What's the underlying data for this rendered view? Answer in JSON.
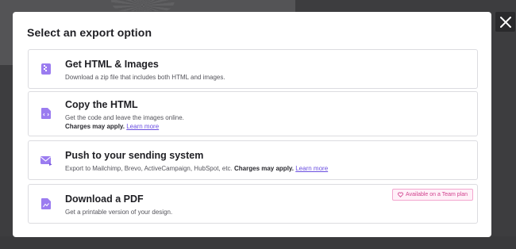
{
  "modal": {
    "title": "Select an export option",
    "close_icon": "close-icon"
  },
  "options": [
    {
      "icon": "zip-file-icon",
      "title": "Get HTML & Images",
      "desc": "Download a zip file that includes both HTML and images."
    },
    {
      "icon": "code-file-icon",
      "title": "Copy the HTML",
      "desc": "Get the code and leave the images online.",
      "charges": "Charges may apply.",
      "link": "Learn more"
    },
    {
      "icon": "send-mail-icon",
      "title": "Push to your sending system",
      "desc": "Export to Mailchimp, Brevo, ActiveCampaign, HubSpot, etc.",
      "charges": "Charges may apply.",
      "link": "Learn more"
    },
    {
      "icon": "pdf-file-icon",
      "title": "Download a PDF",
      "desc": "Get a printable version of your design.",
      "badge": "Available on a Team plan",
      "badge_icon": "heart-icon"
    }
  ],
  "colors": {
    "accent": "#6a4ee0",
    "icon": "#9b7cf0",
    "badge": "#d1428e"
  }
}
